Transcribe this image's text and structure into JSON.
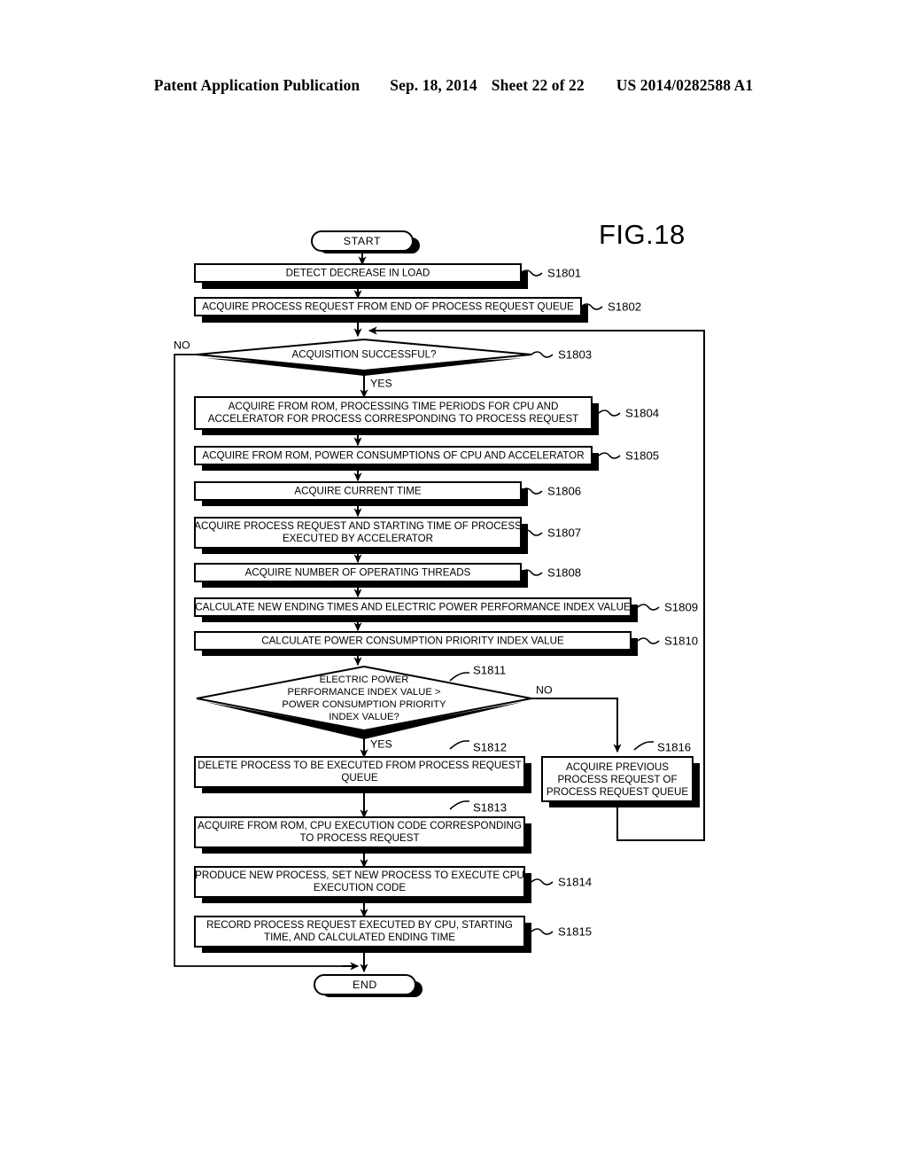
{
  "header": {
    "publication": "Patent Application Publication",
    "date": "Sep. 18, 2014",
    "sheet": "Sheet 22 of 22",
    "number": "US 2014/0282588 A1"
  },
  "figure": {
    "title": "FIG.18"
  },
  "terminals": {
    "start": "START",
    "end": "END"
  },
  "branch_labels": {
    "no_s1803": "NO",
    "yes_s1803": "YES",
    "no_s1811": "NO",
    "yes_s1811": "YES"
  },
  "nodes": [
    {
      "id": "S1801",
      "label": "S1801",
      "type": "process",
      "lines": [
        "DETECT DECREASE IN LOAD"
      ]
    },
    {
      "id": "S1802",
      "label": "S1802",
      "type": "process",
      "lines": [
        "ACQUIRE PROCESS REQUEST FROM END OF PROCESS REQUEST QUEUE"
      ]
    },
    {
      "id": "S1803",
      "label": "S1803",
      "type": "decision",
      "lines": [
        "ACQUISITION SUCCESSFUL?"
      ]
    },
    {
      "id": "S1804",
      "label": "S1804",
      "type": "process",
      "lines": [
        "ACQUIRE FROM ROM, PROCESSING TIME PERIODS FOR CPU AND",
        "ACCELERATOR FOR PROCESS CORRESPONDING TO PROCESS REQUEST"
      ]
    },
    {
      "id": "S1805",
      "label": "S1805",
      "type": "process",
      "lines": [
        "ACQUIRE FROM ROM, POWER CONSUMPTIONS OF CPU AND ACCELERATOR"
      ]
    },
    {
      "id": "S1806",
      "label": "S1806",
      "type": "process",
      "lines": [
        "ACQUIRE CURRENT TIME"
      ]
    },
    {
      "id": "S1807",
      "label": "S1807",
      "type": "process",
      "lines": [
        "ACQUIRE PROCESS REQUEST AND STARTING TIME OF PROCESS",
        "EXECUTED BY ACCELERATOR"
      ]
    },
    {
      "id": "S1808",
      "label": "S1808",
      "type": "process",
      "lines": [
        "ACQUIRE NUMBER OF OPERATING THREADS"
      ]
    },
    {
      "id": "S1809",
      "label": "S1809",
      "type": "process",
      "lines": [
        "CALCULATE NEW ENDING TIMES AND ELECTRIC POWER PERFORMANCE INDEX VALUE"
      ]
    },
    {
      "id": "S1810",
      "label": "S1810",
      "type": "process",
      "lines": [
        "CALCULATE POWER CONSUMPTION PRIORITY INDEX VALUE"
      ]
    },
    {
      "id": "S1811",
      "label": "S1811",
      "type": "decision",
      "lines": [
        "ELECTRIC POWER",
        "PERFORMANCE INDEX VALUE >",
        "POWER CONSUMPTION PRIORITY",
        "INDEX VALUE?"
      ]
    },
    {
      "id": "S1812",
      "label": "S1812",
      "type": "process",
      "lines": [
        "DELETE PROCESS TO BE EXECUTED FROM PROCESS REQUEST",
        "QUEUE"
      ]
    },
    {
      "id": "S1813",
      "label": "S1813",
      "type": "process",
      "lines": [
        "ACQUIRE FROM ROM, CPU EXECUTION CODE CORRESPONDING",
        "TO PROCESS REQUEST"
      ]
    },
    {
      "id": "S1814",
      "label": "S1814",
      "type": "process",
      "lines": [
        "PRODUCE NEW PROCESS, SET NEW PROCESS TO EXECUTE CPU",
        "EXECUTION CODE"
      ]
    },
    {
      "id": "S1815",
      "label": "S1815",
      "type": "process",
      "lines": [
        "RECORD PROCESS REQUEST EXECUTED BY CPU, STARTING",
        "TIME, AND CALCULATED ENDING TIME"
      ]
    },
    {
      "id": "S1816",
      "label": "S1816",
      "type": "process",
      "lines": [
        "ACQUIRE PREVIOUS",
        "PROCESS REQUEST OF",
        "PROCESS REQUEST QUEUE"
      ]
    }
  ],
  "colors": {
    "ink": "#000000",
    "paper": "#ffffff"
  }
}
